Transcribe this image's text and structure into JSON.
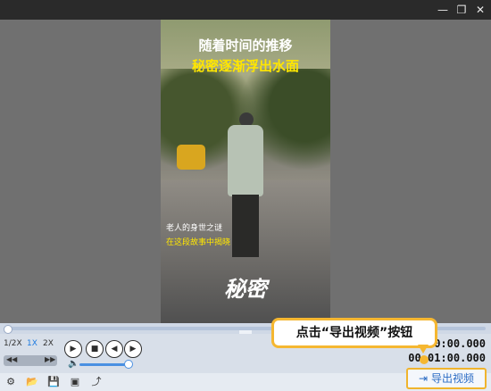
{
  "titlebar": {
    "restore_icon": "restore-icon",
    "minimize_icon": "minimize-icon",
    "close_icon": "close-icon"
  },
  "video": {
    "title_line1": "随着时间的推移",
    "title_line2": "秘密逐渐浮出水面",
    "subtitle_line1": "老人的身世之谜",
    "subtitle_line2": "在这段故事中揭晓",
    "brush_text": "秘密"
  },
  "controls": {
    "speeds": [
      "1/2X",
      "1X",
      "2X"
    ],
    "active_speed": "1X",
    "time_current": "00:00.000",
    "time_total": "00:01:00.000",
    "volume_level": 0.85,
    "progress_level": 0.0
  },
  "callout": {
    "text": "点击“导出视频”按钮"
  },
  "export": {
    "label": "导出视频"
  },
  "colors": {
    "accent": "#f5b731",
    "blue": "#2b6cc4",
    "yellow_text": "#ffe600"
  }
}
